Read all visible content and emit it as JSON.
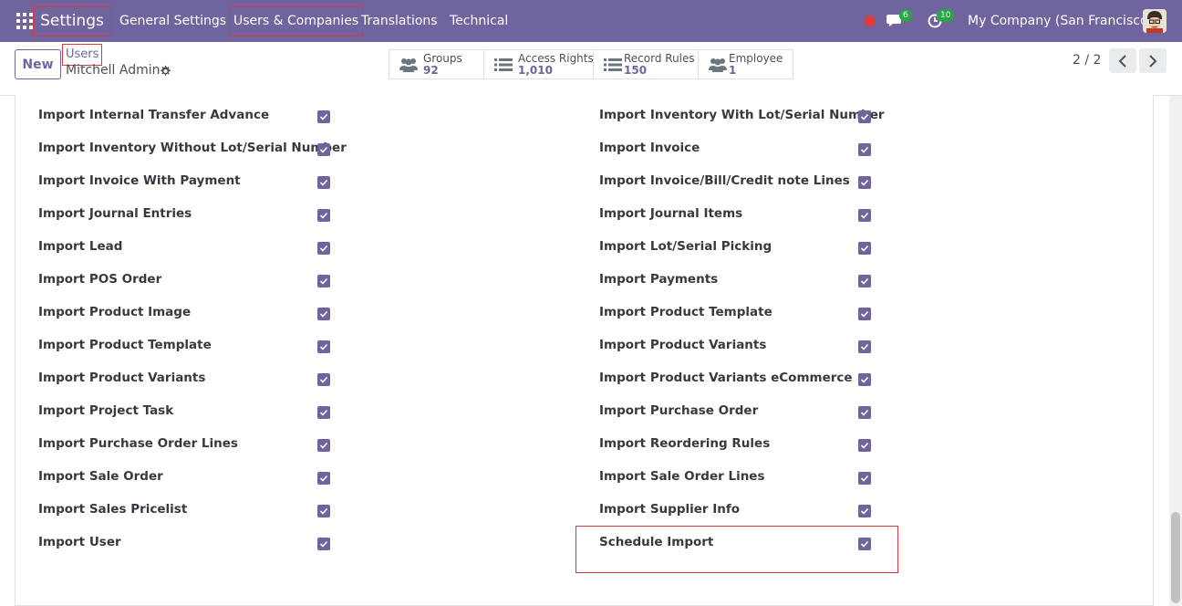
{
  "navbar": {
    "app_title": "Settings",
    "menus": [
      "General Settings",
      "Users & Companies",
      "Translations",
      "Technical"
    ],
    "messages_count": "6",
    "activities_count": "10",
    "company": "My Company (San Francisco)"
  },
  "control_panel": {
    "new_label": "New",
    "breadcrumb": "Users",
    "record_name": "Mitchell Admin",
    "smart_buttons": [
      {
        "label": "Groups",
        "value": "92",
        "icon": "users-icon"
      },
      {
        "label": "Access Rights",
        "value": "1,010",
        "icon": "list-icon"
      },
      {
        "label": "Record Rules",
        "value": "150",
        "icon": "list-icon"
      },
      {
        "label": "Employee",
        "value": "1",
        "icon": "users-icon"
      }
    ],
    "pager": "2 / 2"
  },
  "permissions": {
    "left": [
      {
        "label": "Import Internal Transfer Advance",
        "checked": true
      },
      {
        "label": "Import Inventory Without Lot/Serial Number",
        "checked": true
      },
      {
        "label": "Import Invoice With Payment",
        "checked": true
      },
      {
        "label": "Import Journal Entries",
        "checked": true
      },
      {
        "label": "Import Lead",
        "checked": true
      },
      {
        "label": "Import POS Order",
        "checked": true
      },
      {
        "label": "Import Product Image",
        "checked": true
      },
      {
        "label": "Import Product Template",
        "checked": true
      },
      {
        "label": "Import Product Variants",
        "checked": true
      },
      {
        "label": "Import Project Task",
        "checked": true
      },
      {
        "label": "Import Purchase Order Lines",
        "checked": true
      },
      {
        "label": "Import Sale Order",
        "checked": true
      },
      {
        "label": "Import Sales Pricelist",
        "checked": true
      },
      {
        "label": "Import User",
        "checked": true
      }
    ],
    "right": [
      {
        "label": "Import Inventory With Lot/Serial Number",
        "checked": true
      },
      {
        "label": "Import Invoice",
        "checked": true
      },
      {
        "label": "Import Invoice/Bill/Credit note Lines",
        "checked": true
      },
      {
        "label": "Import Journal Items",
        "checked": true
      },
      {
        "label": "Import Lot/Serial Picking",
        "checked": true
      },
      {
        "label": "Import Payments",
        "checked": true
      },
      {
        "label": "Import Product Template",
        "checked": true
      },
      {
        "label": "Import Product Variants",
        "checked": true
      },
      {
        "label": "Import Product Variants eCommerce",
        "checked": true
      },
      {
        "label": "Import Purchase Order",
        "checked": true
      },
      {
        "label": "Import Reordering Rules",
        "checked": true
      },
      {
        "label": "Import Sale Order Lines",
        "checked": true
      },
      {
        "label": "Import Supplier Info",
        "checked": true
      },
      {
        "label": "Schedule Import",
        "checked": true
      }
    ]
  },
  "colors": {
    "brand": "#71639e",
    "highlight": "#d83b3b",
    "badge": "#28a745",
    "record_dot": "#e03b3b"
  }
}
